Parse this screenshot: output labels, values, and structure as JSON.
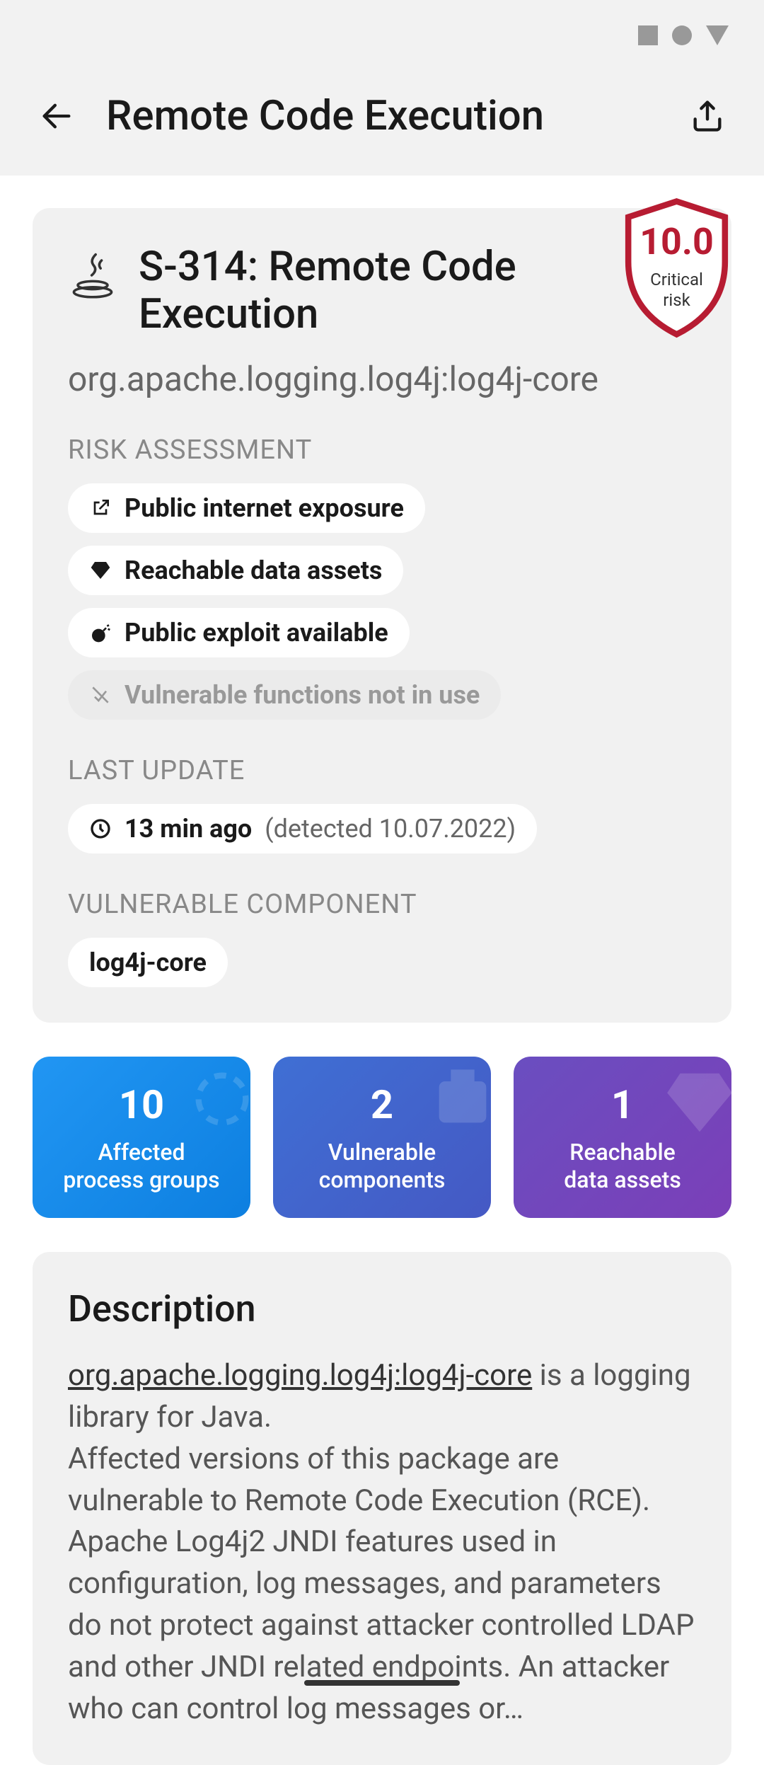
{
  "header": {
    "title": "Remote Code Execution"
  },
  "vuln": {
    "id_title": "S-314: Remote Code Execution",
    "package": "org.apache.logging.log4j:log4j-core",
    "score": "10.0",
    "risk_line1": "Critical",
    "risk_line2": "risk"
  },
  "sections": {
    "risk_assessment": "RISK ASSESSMENT",
    "last_update": "LAST UPDATE",
    "vulnerable_component": "VULNERABLE COMPONENT"
  },
  "chips": {
    "exposure": "Public internet exposure",
    "reachable": "Reachable data assets",
    "exploit": "Public exploit available",
    "not_in_use": "Vulnerable functions not in use",
    "time_ago": "13 min ago",
    "detected": "(detected 10.07.2022)",
    "component": "log4j-core"
  },
  "metrics": [
    {
      "num": "10",
      "label1": "Affected",
      "label2": "process groups"
    },
    {
      "num": "2",
      "label1": "Vulnerable",
      "label2": "components"
    },
    {
      "num": "1",
      "label1": "Reachable",
      "label2": "data assets"
    }
  ],
  "description": {
    "title": "Description",
    "link": "org.apache.logging.log4j:log4j-core",
    "text_after_link": " is a logging library for Java.",
    "body": "Affected versions of this package are vulnerable to Remote Code Execution (RCE). Apache Log4j2 JNDI features used in configuration, log messages, and parameters do not protect against attacker controlled LDAP and other JNDI related endpoints. An attacker who can control log messages or…"
  }
}
